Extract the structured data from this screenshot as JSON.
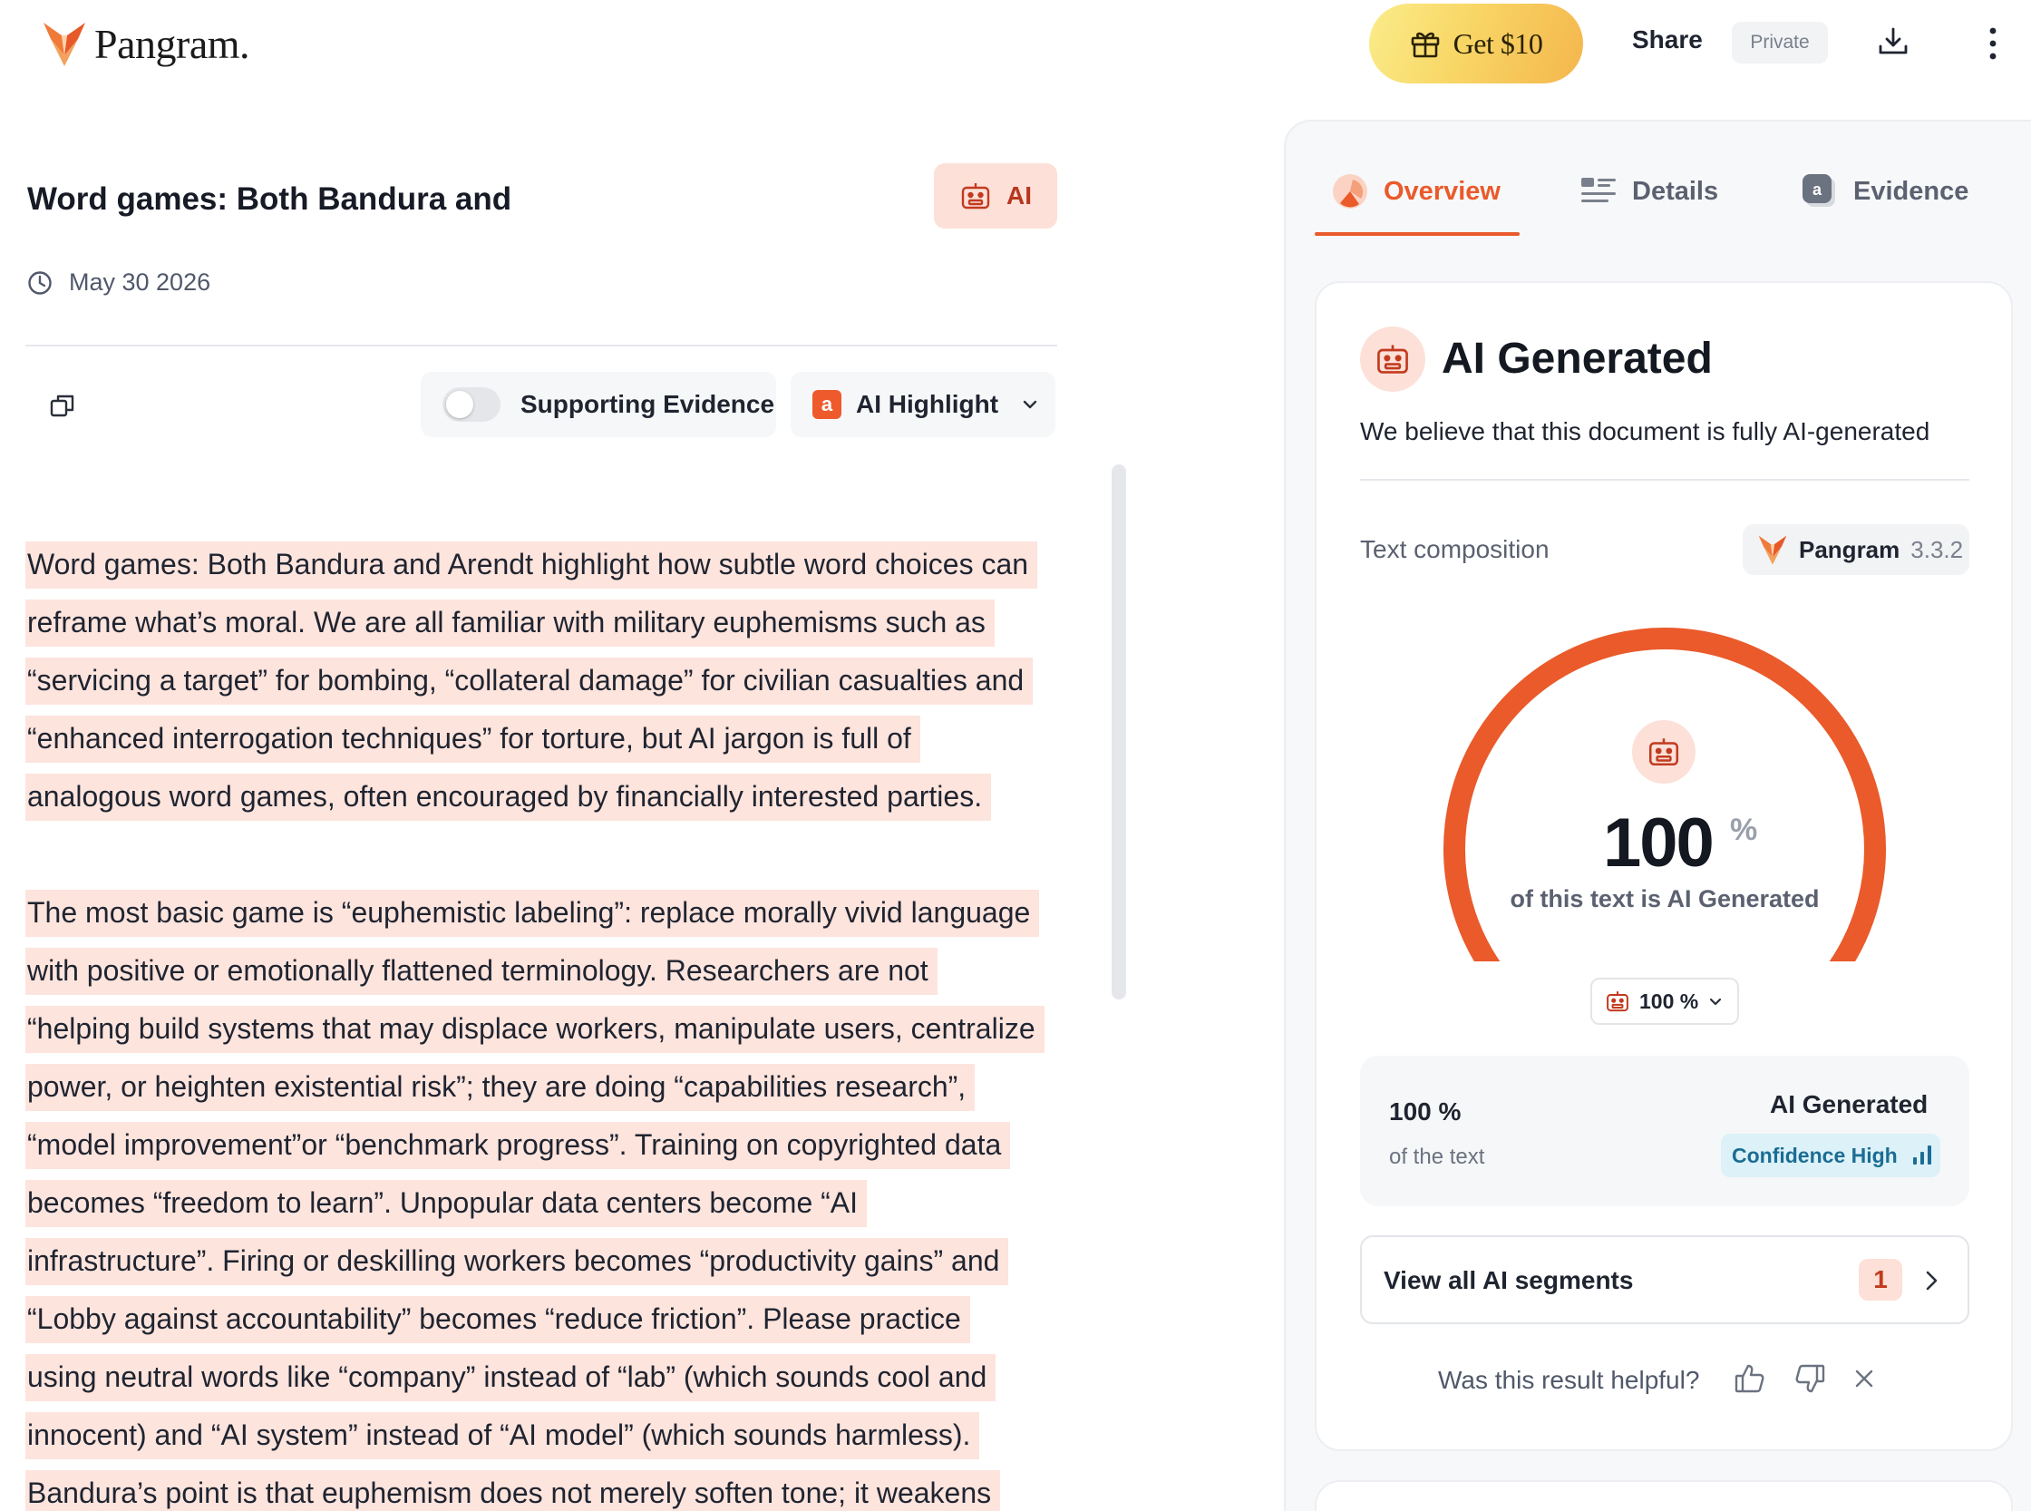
{
  "header": {
    "brand": "Pangram.",
    "promo_label": "Get $10",
    "share_label": "Share",
    "visibility_label": "Private"
  },
  "document": {
    "title": "Word games: Both Bandura and",
    "badge_label": "AI",
    "date": "May 30 2026",
    "toolbar": {
      "supporting_evidence_label": "Supporting Evidence",
      "supporting_evidence_on": false,
      "highlight_chip": "a",
      "highlight_label": "AI Highlight"
    },
    "paragraphs": [
      [
        "Word games: Both Bandura and Arendt highlight how subtle word choices can",
        "reframe what’s moral. We are all familiar with military euphemisms such as",
        "“servicing a target” for bombing, “collateral damage” for civilian casualties and",
        "“enhanced interrogation techniques” for torture, but AI jargon is full of",
        "analogous word games, often encouraged by financially interested parties."
      ],
      [
        "The most basic game is “euphemistic labeling”: replace morally vivid language",
        "with positive or emotionally flattened terminology. Researchers are not",
        "“helping build systems that may displace workers, manipulate users, centralize",
        "power, or heighten existential risk”; they are doing “capabilities research”,",
        "“model improvement”or “benchmark progress”. Training on copyrighted data",
        "becomes “freedom to learn”. Unpopular data centers become “AI",
        "infrastructure”.  Firing or deskilling workers becomes “productivity gains” and",
        "“Lobby against accountability” becomes “reduce friction”. Please practice",
        "using neutral words like “company” instead of “lab” (which sounds cool and",
        "innocent) and “AI system” instead of “AI model” (which sounds harmless).",
        "Bandura’s point is that euphemism does not merely soften tone; it weakens"
      ]
    ]
  },
  "panel": {
    "tabs": [
      {
        "label": "Overview",
        "active": true
      },
      {
        "label": "Details",
        "active": false
      },
      {
        "label": "Evidence",
        "active": false
      }
    ],
    "evidence_chip": "a",
    "result": {
      "title": "AI Generated",
      "subtitle": "We believe that this document is fully AI-generated",
      "composition_label": "Text composition",
      "model_name": "Pangram",
      "model_version": "3.3.2",
      "gauge_value": "100",
      "gauge_fraction": 1.0,
      "gauge_unit": "%",
      "gauge_caption": "of this text is AI Generated",
      "select_label": "100 %",
      "summary_pct": "100 %",
      "summary_of": "of the text",
      "summary_label": "AI Generated",
      "confidence_label": "Confidence High",
      "view_all_label": "View all AI segments",
      "segment_count": "1",
      "feedback_question": "Was this result helpful?"
    }
  },
  "colors": {
    "accent": "#ea5a2a",
    "highlight": "#fde4dd",
    "badge_bg": "#fde0d8",
    "confidence_bg": "#dcf1f8",
    "confidence_text": "#1b6d93"
  },
  "icons": {
    "brand": "fox-logo-icon",
    "promo": "gift-icon",
    "download": "download-icon",
    "menu": "kebab-menu-icon",
    "ai": "robot-icon",
    "date": "clock-icon",
    "copy": "copy-icon",
    "dropdown": "chevron-down-icon",
    "tab_overview": "gauge-icon",
    "tab_details": "list-lines-icon",
    "feedback_up": "thumbs-up-icon",
    "feedback_down": "thumbs-down-icon",
    "dismiss": "close-icon"
  }
}
